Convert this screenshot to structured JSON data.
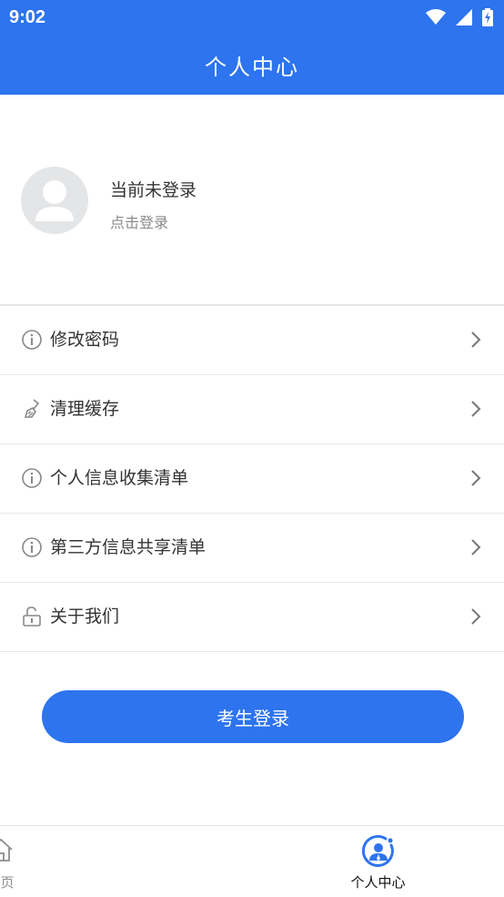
{
  "status_bar": {
    "time": "9:02",
    "icons": [
      "wifi-icon",
      "signal-icon",
      "battery-icon"
    ]
  },
  "header": {
    "title": "个人中心"
  },
  "profile": {
    "name": "当前未登录",
    "subtitle": "点击登录",
    "avatar_icon": "avatar-placeholder-icon"
  },
  "menu": {
    "items": [
      {
        "label": "修改密码",
        "icon": "info-icon"
      },
      {
        "label": "清理缓存",
        "icon": "broom-icon"
      },
      {
        "label": "个人信息收集清单",
        "icon": "info-icon"
      },
      {
        "label": "第三方信息共享清单",
        "icon": "info-icon"
      },
      {
        "label": "关于我们",
        "icon": "unlock-icon"
      }
    ]
  },
  "login_button": {
    "label": "考生登录"
  },
  "bottom_nav": {
    "items": [
      {
        "label": "首页",
        "icon": "home-icon",
        "active": false
      },
      {
        "label": "个人中心",
        "icon": "user-profile-icon",
        "active": true
      }
    ]
  },
  "colors": {
    "primary": "#2d74ee",
    "text": "#333333",
    "muted": "#8a8a8a",
    "divider": "#e8e8e8"
  }
}
